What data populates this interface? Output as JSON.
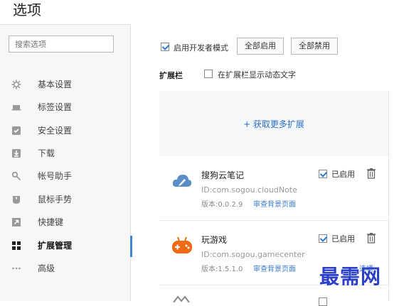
{
  "page": {
    "title": "选项"
  },
  "sidebar": {
    "search_placeholder": "搜索选项",
    "items": [
      {
        "label": "基本设置",
        "icon": "gear-icon"
      },
      {
        "label": "标签设置",
        "icon": "tab-icon"
      },
      {
        "label": "安全设置",
        "icon": "shield-check-icon"
      },
      {
        "label": "下载",
        "icon": "download-icon"
      },
      {
        "label": "帐号助手",
        "icon": "key-icon"
      },
      {
        "label": "鼠标手势",
        "icon": "mouse-icon"
      },
      {
        "label": "快捷键",
        "icon": "shortcut-icon"
      },
      {
        "label": "扩展管理",
        "icon": "grid-icon",
        "active": true
      },
      {
        "label": "高级",
        "icon": "more-dots-icon"
      }
    ]
  },
  "toolbar": {
    "dev_mode_label": "启用开发者模式",
    "dev_mode_checked": true,
    "enable_all_label": "全部启用",
    "disable_all_label": "全部禁用"
  },
  "extbar": {
    "label": "扩展栏",
    "show_dynamic_label": "在扩展栏显示动态文字",
    "show_dynamic_checked": false
  },
  "get_more": {
    "label": "+ 获取更多扩展"
  },
  "extensions": [
    {
      "name": "搜狗云笔记",
      "id": "ID:com.sogou.cloudNote",
      "version": "版本:0.0.2.9",
      "link": "审查背景页面",
      "enabled_label": "已启用",
      "enabled": true,
      "icon": "cloud-note-icon"
    },
    {
      "name": "玩游戏",
      "id": "ID:com.sogou.gamecenter",
      "version": "版本:1.5.1.0",
      "link": "审查背景页面",
      "enabled_label": "已启用",
      "enabled": true,
      "options_label": "选项",
      "icon": "gamepad-icon"
    }
  ],
  "watermark": "最需网",
  "colors": {
    "accent": "#3b87d4",
    "link": "#2a6fc6",
    "watermark": "#2b3fc7"
  }
}
